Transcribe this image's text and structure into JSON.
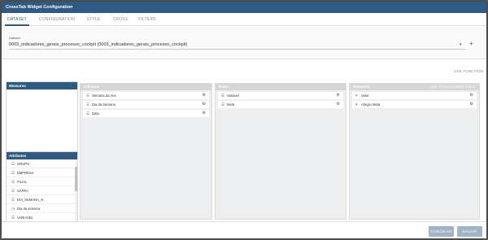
{
  "window": {
    "title": "CrossTab Widget Configuration"
  },
  "tabs": [
    "DATASET",
    "CONFIGURATION",
    "STYLE",
    "CROSS",
    "FILTERS"
  ],
  "dataset": {
    "label": "Dataset",
    "value": "0003_indicadores_gerais_processo_cockpit (0003_indicadores_gerais_processo_cockpit)",
    "caret_icon": "caret-down-icon",
    "add_icon": "plus-icon"
  },
  "use_function": "USE FUNCTION",
  "side": {
    "measures_title": "Measures",
    "attributes_title": "Attributes",
    "attributes": [
      {
        "icon": "list-icon",
        "label": "GRUPO"
      },
      {
        "icon": "list-icon",
        "label": "EMPRESA"
      },
      {
        "icon": "list-icon",
        "label": "FILIAL"
      },
      {
        "icon": "list-icon",
        "label": "SAFRA"
      },
      {
        "icon": "list-icon",
        "label": "DIA_SEMANA_N"
      },
      {
        "icon": "clock-icon",
        "label": "Dia da semana"
      },
      {
        "icon": "list-icon",
        "label": "VARIAVEL"
      }
    ]
  },
  "panels": {
    "columns": {
      "title": "Columns",
      "fields": [
        {
          "icon": "list-icon",
          "label": "Semana do Ano"
        },
        {
          "icon": "list-icon",
          "label": "Dia da Semana"
        },
        {
          "icon": "list-icon",
          "label": "Data"
        }
      ]
    },
    "rows": {
      "title": "Rows",
      "fields": [
        {
          "icon": "list-icon",
          "label": "Variável"
        },
        {
          "icon": "list-icon",
          "label": "Meta"
        }
      ]
    },
    "measures": {
      "title": "Measures",
      "extra": "ADD CALCULATED FIELD",
      "fields": [
        {
          "icon": "hash-icon",
          "label": "Valor"
        },
        {
          "icon": "hash-icon",
          "label": "Atingiu Meta"
        }
      ]
    }
  },
  "footer": {
    "cancel_label": "CANCELAR",
    "save_label": "SALVAR"
  },
  "colors": {
    "primary": "#2f5a82",
    "panel_bg": "#eceef0",
    "button_disabled": "#9fb4c7"
  }
}
